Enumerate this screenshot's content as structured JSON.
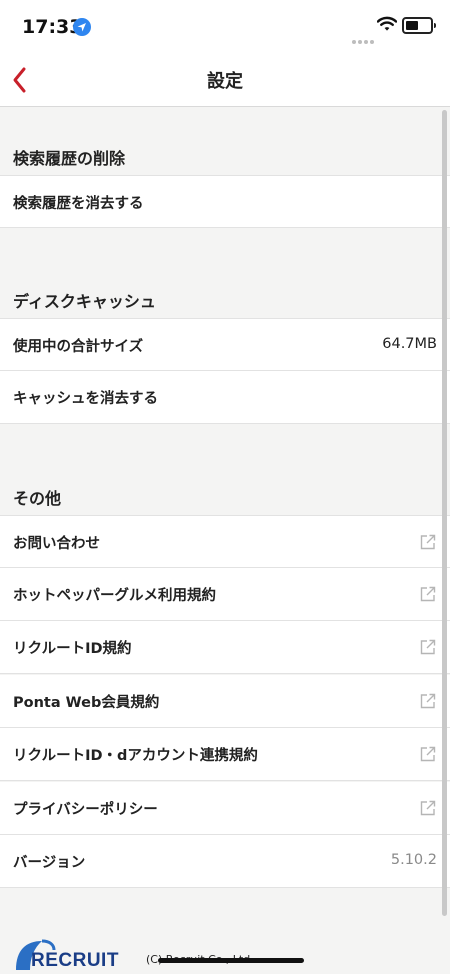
{
  "status_bar": {
    "time": "17:33"
  },
  "nav": {
    "title": "設定"
  },
  "sections": {
    "history": {
      "header": "検索履歴の削除",
      "rows": [
        {
          "label": "検索履歴を消去する"
        }
      ]
    },
    "cache": {
      "header": "ディスクキャッシュ",
      "rows": [
        {
          "label": "使用中の合計サイズ",
          "value": "64.7MB"
        },
        {
          "label": "キャッシュを消去する"
        }
      ]
    },
    "other": {
      "header": "その他",
      "rows": [
        {
          "label": "お問い合わせ",
          "icon": "external-link-icon"
        },
        {
          "label": "ホットペッパーグルメ利用規約",
          "icon": "external-link-icon"
        },
        {
          "label": "リクルートID規約",
          "icon": "external-link-icon"
        },
        {
          "label": "Ponta Web会員規約",
          "icon": "external-link-icon"
        },
        {
          "label": "リクルートID・dアカウント連携規約",
          "icon": "external-link-icon"
        },
        {
          "label": "プライバシーポリシー",
          "icon": "external-link-icon"
        },
        {
          "label": "バージョン",
          "value": "5.10.2"
        }
      ]
    }
  },
  "footer": {
    "logo_text": "RECRUIT",
    "copyright": "(C) Recruit Co., Ltd."
  },
  "colors": {
    "accent": "#c8202a",
    "logo": "#1a3d86",
    "background": "#f4f4f3"
  }
}
